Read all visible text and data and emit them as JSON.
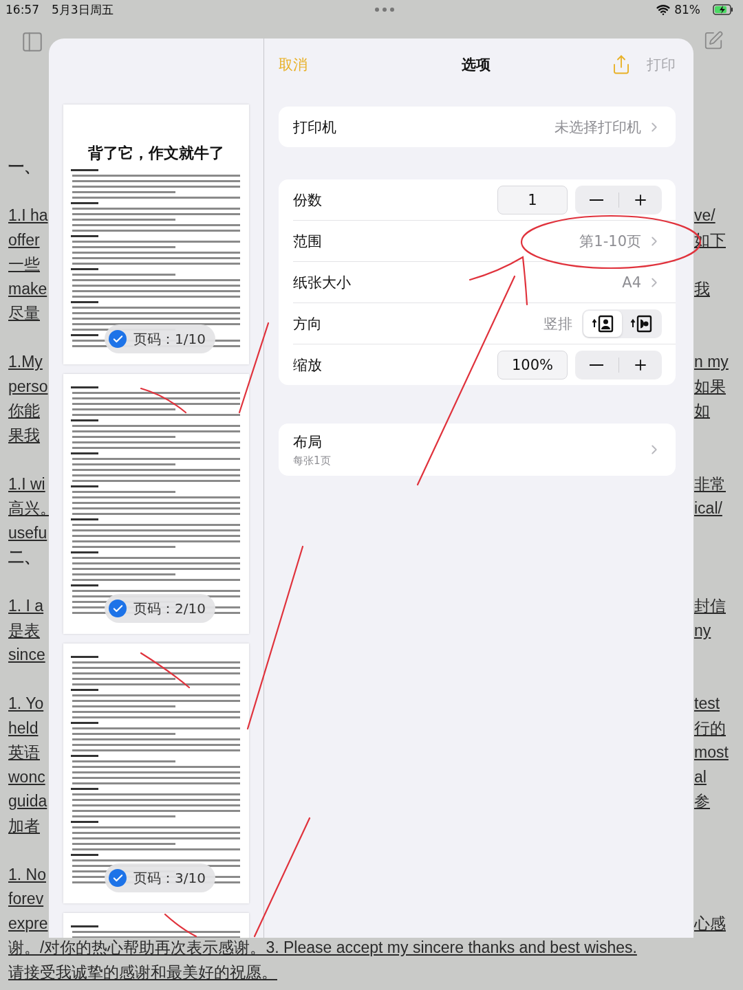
{
  "status_bar": {
    "time": "16:57",
    "date": "5月3日周五",
    "battery": "81%"
  },
  "background_document": {
    "paragraphs": [
      [
        {
          "left": "一、",
          "kind": "heading"
        }
      ],
      [
        {
          "left": "1.I ha",
          "right": "ve/"
        },
        {
          "left": "offer",
          "right": "如下"
        },
        {
          "left": "一些"
        },
        {
          "left": "make",
          "right": "我"
        },
        {
          "left": "尽量"
        }
      ],
      [
        {
          "left": "1.My",
          "right": "n my"
        },
        {
          "left": "perso",
          "right": "如果"
        },
        {
          "left": "你能",
          "right": "如"
        },
        {
          "left": "果我"
        }
      ],
      [
        {
          "left": "1.I wi",
          "right": "非常"
        },
        {
          "left": "高兴。",
          "right": "ical/"
        },
        {
          "left": "usefu"
        },
        {
          "left": "二、",
          "kind": "heading"
        }
      ],
      [
        {
          "left": "1. I a",
          "right": "封信"
        },
        {
          "left": "是表",
          "right": "ny"
        },
        {
          "left": "since"
        }
      ],
      [
        {
          "left": "1. Yo",
          "right": "test"
        },
        {
          "left": "held",
          "right": "行的"
        },
        {
          "left": "英语",
          "right": "most"
        },
        {
          "left": "wonc",
          "right": "al"
        },
        {
          "left": "guida",
          "right": "参"
        },
        {
          "left": "加者"
        }
      ],
      [
        {
          "left": "1. No"
        },
        {
          "left": "forev"
        },
        {
          "left": "expre",
          "right": "心感"
        },
        {
          "left": "谢。/对你的热心帮助再次表示感谢。3. Please accept my sincere thanks and best wishes."
        },
        {
          "left": "请接受我诚挚的感谢和最美好的祝愿。"
        }
      ]
    ]
  },
  "print_sheet": {
    "previews": [
      {
        "kind": "page",
        "title": "背了它，作文就牛了",
        "badge": "页码：1/10",
        "selected": true
      },
      {
        "kind": "page",
        "badge": "页码：2/10",
        "selected": true
      },
      {
        "kind": "page",
        "badge": "页码：3/10",
        "selected": true
      },
      {
        "kind": "partial"
      }
    ],
    "header": {
      "cancel": "取消",
      "title": "选项",
      "print": "打印",
      "print_disabled": true
    },
    "printer": {
      "label": "打印机",
      "value": "未选择打印机"
    },
    "options": [
      {
        "kind": "stepper",
        "label": "份数",
        "value": "1"
      },
      {
        "kind": "link",
        "label": "范围",
        "value": "第1-10页"
      },
      {
        "kind": "link",
        "label": "纸张大小",
        "value": "A4"
      },
      {
        "kind": "orientation",
        "label": "方向",
        "value": "竖排",
        "options": [
          {
            "selected": true
          },
          {
            "selected": false
          }
        ]
      },
      {
        "kind": "stepper",
        "label": "缩放",
        "value": "100%"
      }
    ],
    "layout": {
      "label": "布局",
      "subtitle": "每张1页"
    }
  }
}
